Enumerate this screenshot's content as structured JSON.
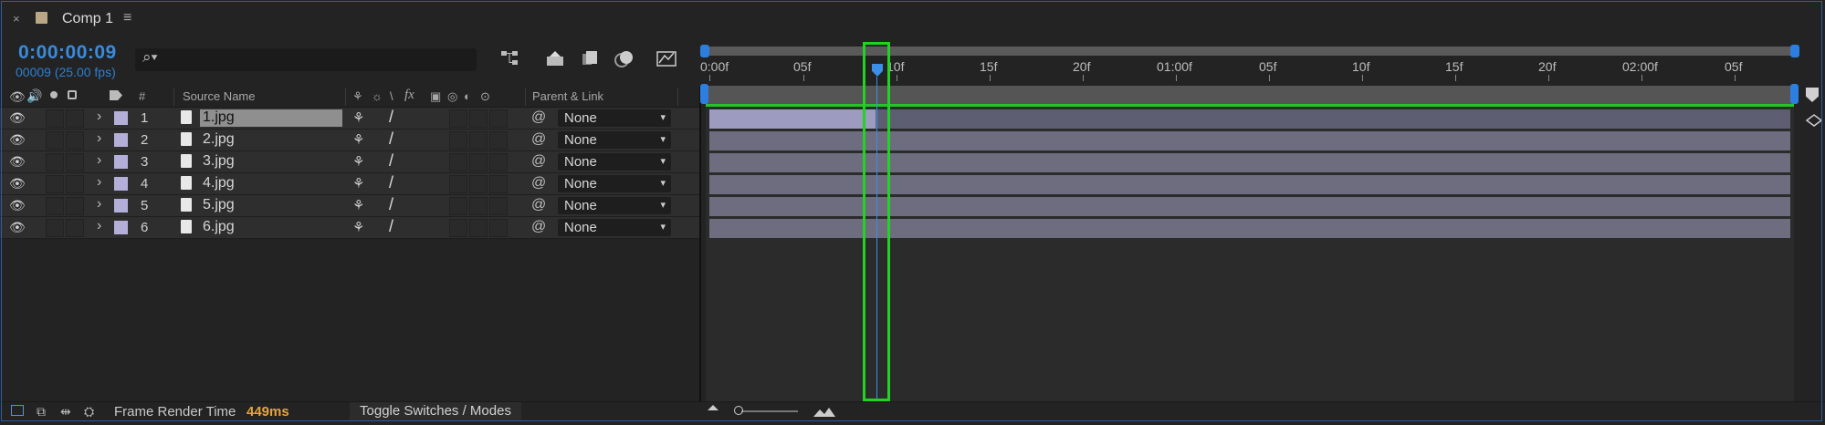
{
  "panel": {
    "close_glyph": "×",
    "title": "Comp 1",
    "menu_glyph": "≡"
  },
  "header": {
    "timecode": "0:00:00:09",
    "frame_info": "00009 (25.00 fps)",
    "search_icon": "⌕▾",
    "search_placeholder": ""
  },
  "columns": {
    "number": "#",
    "source_name": "Source Name",
    "parent_link": "Parent & Link",
    "switch_glyphs": [
      "⚘",
      "☼",
      "\\",
      "fx",
      "▣",
      "◎",
      "◐",
      "⊙"
    ]
  },
  "layers": [
    {
      "num": "1",
      "name": "1.jpg",
      "parent": "None",
      "selected": true
    },
    {
      "num": "2",
      "name": "2.jpg",
      "parent": "None",
      "selected": false
    },
    {
      "num": "3",
      "name": "3.jpg",
      "parent": "None",
      "selected": false
    },
    {
      "num": "4",
      "name": "4.jpg",
      "parent": "None",
      "selected": false
    },
    {
      "num": "5",
      "name": "5.jpg",
      "parent": "None",
      "selected": false
    },
    {
      "num": "6",
      "name": "6.jpg",
      "parent": "None",
      "selected": false
    }
  ],
  "ruler": {
    "labels": [
      "0:00f",
      "05f",
      "10f",
      "15f",
      "20f",
      "01:00f",
      "05f",
      "10f",
      "15f",
      "20f",
      "02:00f",
      "05f"
    ]
  },
  "footer": {
    "render_label": "Frame Render Time",
    "render_value": "449ms",
    "toggle_label": "Toggle Switches / Modes"
  },
  "colors": {
    "timecode": "#3a8bdc",
    "render_value": "#e5a342",
    "layer_swatch": "#b3afd9",
    "highlight": "#22d322"
  }
}
